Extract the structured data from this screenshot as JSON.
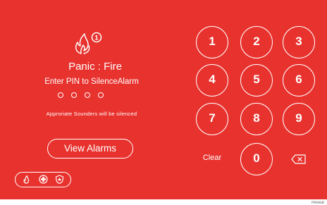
{
  "screen": {
    "title": "Panic : Fire",
    "prompt": "Enter PIN to SilenceAlarm",
    "note": "Approriate Sounders will be silenced",
    "alarm_count": "1",
    "pin_slots": 4,
    "pin_entered": 0
  },
  "buttons": {
    "view_alarms": "View Alarms",
    "clear": "Clear"
  },
  "keypad": {
    "keys": [
      "1",
      "2",
      "3",
      "4",
      "5",
      "6",
      "7",
      "8",
      "9",
      "0"
    ]
  },
  "mode_icons": [
    "fire-icon",
    "medical-icon",
    "police-icon"
  ],
  "product_label": "PROHUB",
  "colors": {
    "background": "#e8322e",
    "foreground": "#ffffff"
  }
}
